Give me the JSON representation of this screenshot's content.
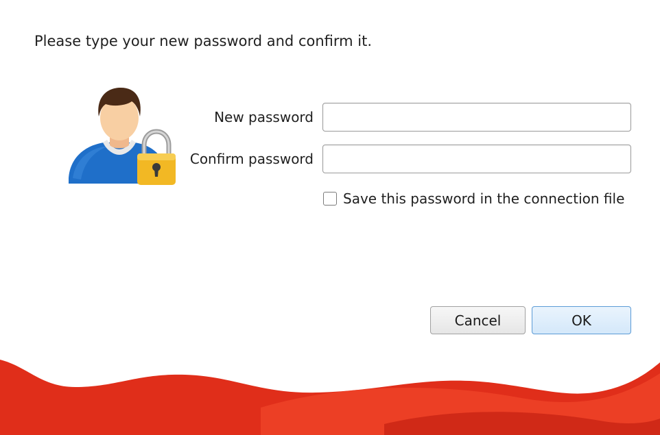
{
  "dialog": {
    "instruction": "Please type your new password and confirm it."
  },
  "form": {
    "new_password_label": "New password",
    "new_password_value": "",
    "confirm_password_label": "Confirm password",
    "confirm_password_value": "",
    "save_password_label": "Save this password in the connection file",
    "save_password_checked": false
  },
  "buttons": {
    "cancel_label": "Cancel",
    "ok_label": "OK"
  },
  "icons": {
    "avatar": "user-lock-icon",
    "checkbox": "checkbox-unchecked-icon"
  },
  "colors": {
    "accent_red": "#e8321f",
    "ok_border": "#5a9ad6",
    "lock_gold": "#f2b824",
    "shirt_blue": "#1f6fc9"
  }
}
